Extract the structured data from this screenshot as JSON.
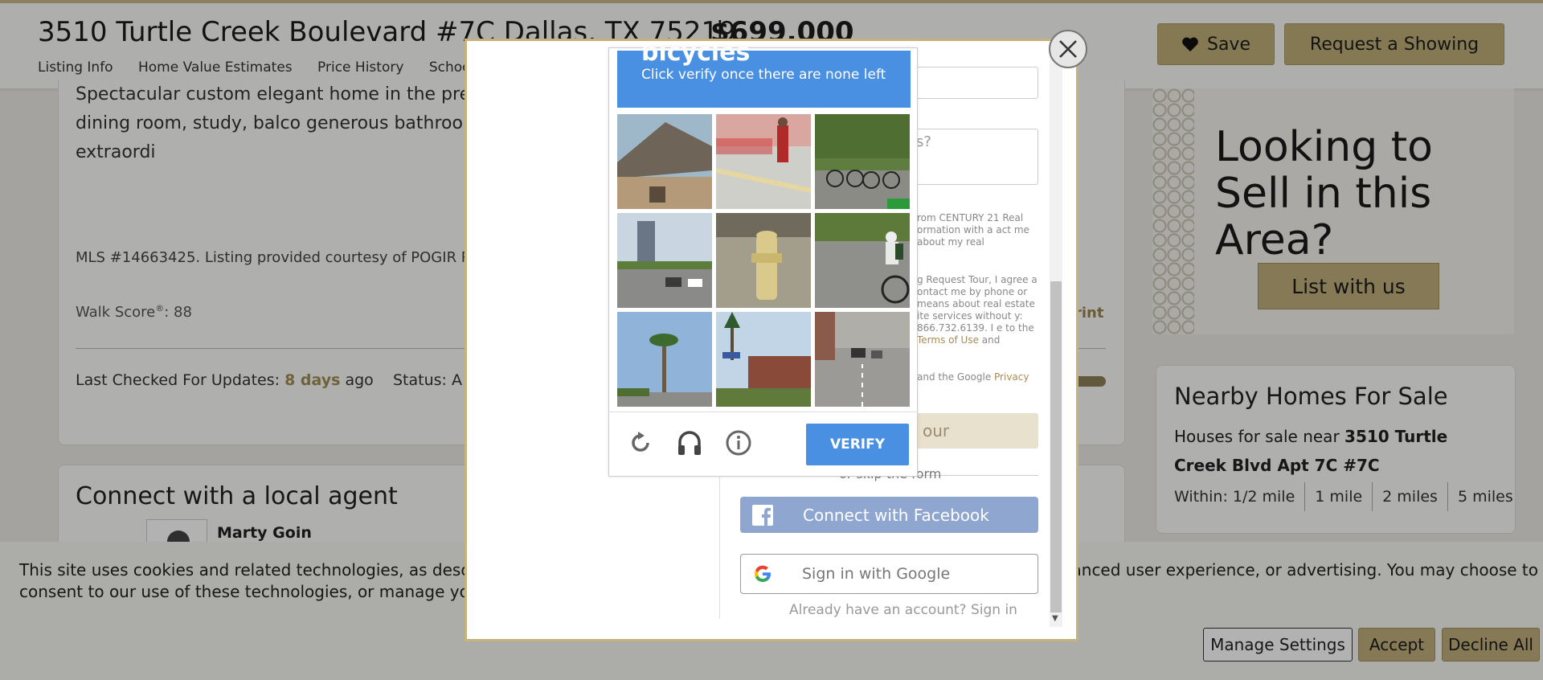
{
  "header": {
    "address": "3510 Turtle Creek Boulevard #7C Dallas, TX 75219",
    "price": "$699,000",
    "nav": [
      "Listing Info",
      "Home Value Estimates",
      "Price History",
      "School"
    ],
    "save_label": "Save",
    "request_label": "Request a Showing"
  },
  "listing": {
    "description": "Spectacular custom elegant home in the pre                                                                                   le Creek. Designed for living, intimate occasion spaces extra large dining room, study, balco generous bathrooms. The Claridge is known                                                                                 ol, racquet ball court and dog park. An extraordi",
    "mls": "MLS #14663425. Listing provided courtesy of POGIR R",
    "walk_label": "Walk Score",
    "walk_sup": "®",
    "walk_value": ": 88",
    "print": "rint",
    "checked_label": "Last Checked For Updates: ",
    "checked_value": "8 days",
    "checked_suffix": " ago",
    "status_label": "Status: A"
  },
  "agent": {
    "title": "Connect with a local agent",
    "name": "Marty Goin"
  },
  "sell": {
    "title": "Looking to Sell in this Area?",
    "button": "List with us"
  },
  "nearby": {
    "title": "Nearby Homes For Sale",
    "sub_prefix": "Houses for sale near ",
    "sub_bold": "3510 Turtle Creek Blvd Apt 7C #7C",
    "within_label": "Within: ",
    "distances": [
      "1/2 mile",
      "1 mile",
      "2 miles",
      "5 miles"
    ]
  },
  "cookie": {
    "text_a": "This site uses cookies and related technologies, as describ",
    "text_b": "nhanced user experience, or advertising. You may choose to",
    "text_c": "consent to our use of these technologies, or manage your",
    "manage": "Manage Settings",
    "accept": "Accept",
    "decline": "Decline All"
  },
  "modal": {
    "textarea_placeholder": "s?",
    "fine_1": "rom CENTURY 21 Real ormation with a act me about my real",
    "fine_2": "g Request Tour, I agree a ontact me by phone or means about real estate ite services without y: 866.732.6139. I e to the ",
    "fine_2_link_a": "Terms of Use",
    "fine_2_and": " and",
    "fine_3": "and the Google ",
    "fine_3_link": "Privacy",
    "tour_button": "our",
    "skip": "or skip the form",
    "facebook": "Connect with Facebook",
    "google": "Sign in with Google",
    "already": "Already have an account? Sign in"
  },
  "captcha": {
    "target_word": "bicycles",
    "instruction": "Click verify once there are none left",
    "verify": "VERIFY",
    "tiles": [
      "house-roof",
      "sidewalk-bike-rack",
      "bicycles-parked",
      "city-street",
      "fire-hydrant",
      "cyclist",
      "palm-tree",
      "brick-house",
      "street-traffic"
    ]
  },
  "colors": {
    "gold": "#c0ae7a",
    "captcha_blue": "#4a90e2",
    "facebook": "#8fa6d1"
  }
}
